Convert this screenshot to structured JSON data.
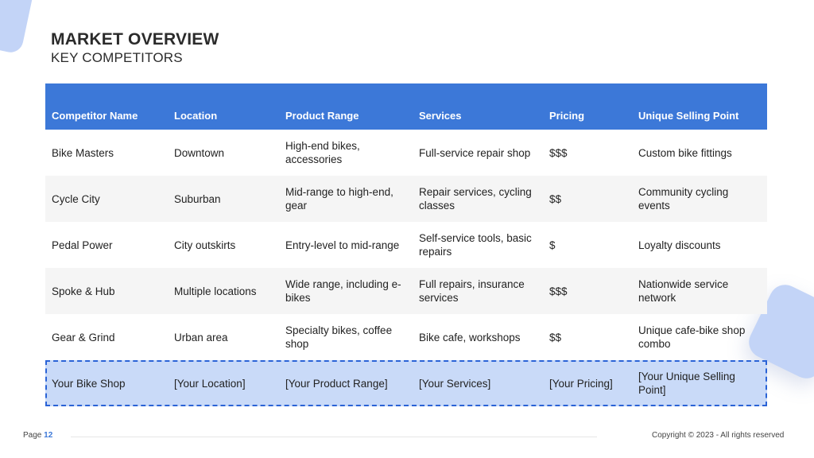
{
  "slide": {
    "title": "MARKET OVERVIEW",
    "subtitle": "KEY COMPETITORS"
  },
  "table": {
    "headers": [
      "Competitor Name",
      "Location",
      "Product Range",
      "Services",
      "Pricing",
      "Unique Selling Point"
    ],
    "rows": [
      [
        "Bike Masters",
        "Downtown",
        "High-end bikes, accessories",
        "Full-service repair shop",
        "$$$",
        "Custom bike fittings"
      ],
      [
        "Cycle City",
        "Suburban",
        "Mid-range to high-end, gear",
        "Repair services, cycling classes",
        "$$",
        "Community cycling events"
      ],
      [
        "Pedal Power",
        "City outskirts",
        "Entry-level to mid-range",
        "Self-service tools, basic repairs",
        "$",
        "Loyalty discounts"
      ],
      [
        "Spoke & Hub",
        "Multiple locations",
        "Wide range, including e-bikes",
        "Full repairs, insurance services",
        "$$$",
        "Nationwide service network"
      ],
      [
        "Gear & Grind",
        "Urban area",
        "Specialty bikes, coffee shop",
        "Bike cafe, workshops",
        "$$",
        "Unique cafe-bike shop combo"
      ],
      [
        "Your Bike Shop",
        "[Your Location]",
        "[Your Product Range]",
        "[Your Services]",
        "[Your Pricing]",
        "[Your Unique Selling Point]"
      ]
    ]
  },
  "footer": {
    "page_label": "Page",
    "page_number": "12",
    "copyright": "Copyright © 2023 - All rights reserved"
  },
  "colors": {
    "header_bg": "#3c78d8",
    "highlight_bg": "#c9daf8",
    "dash_border": "#2a63d6",
    "accent_shape": "#c3d4f7"
  }
}
